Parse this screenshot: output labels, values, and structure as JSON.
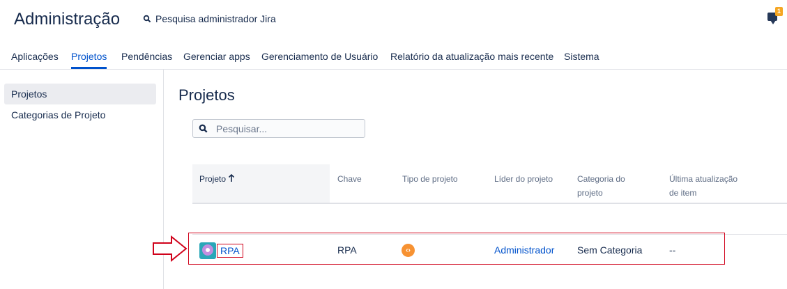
{
  "header": {
    "title": "Administração",
    "search_text": "Pesquisa administrador Jira",
    "notification_count": "1"
  },
  "tabs": [
    {
      "label": "Aplicações"
    },
    {
      "label": "Projetos"
    },
    {
      "label": "Pendências"
    },
    {
      "label": "Gerenciar apps"
    },
    {
      "label": "Gerenciamento de Usuário"
    },
    {
      "label": "Relatório da atualização mais recente"
    },
    {
      "label": "Sistema"
    }
  ],
  "active_tab": "Projetos",
  "sidebar": {
    "items": [
      {
        "label": "Projetos"
      },
      {
        "label": "Categorias de Projeto"
      }
    ]
  },
  "main": {
    "title": "Projetos",
    "search_placeholder": "Pesquisar...",
    "table": {
      "columns": [
        {
          "label": "Projeto"
        },
        {
          "label": "Chave"
        },
        {
          "label": "Tipo de projeto"
        },
        {
          "label": "Líder do projeto"
        },
        {
          "label": "Categoria do projeto"
        },
        {
          "label": "Última atualização de item"
        }
      ],
      "sort_icon": "arrow-up-icon",
      "rows": [
        {
          "project": "RPA",
          "key": "RPA",
          "type_icon": "software-project-icon",
          "lead": "Administrador",
          "category": "Sem Categoria",
          "last_update": "--"
        }
      ]
    }
  },
  "colors": {
    "accent": "#0052cc",
    "text": "#172b4d",
    "annotation": "#d0021b",
    "project_type": "#f79232",
    "badge": "#f5a623"
  }
}
